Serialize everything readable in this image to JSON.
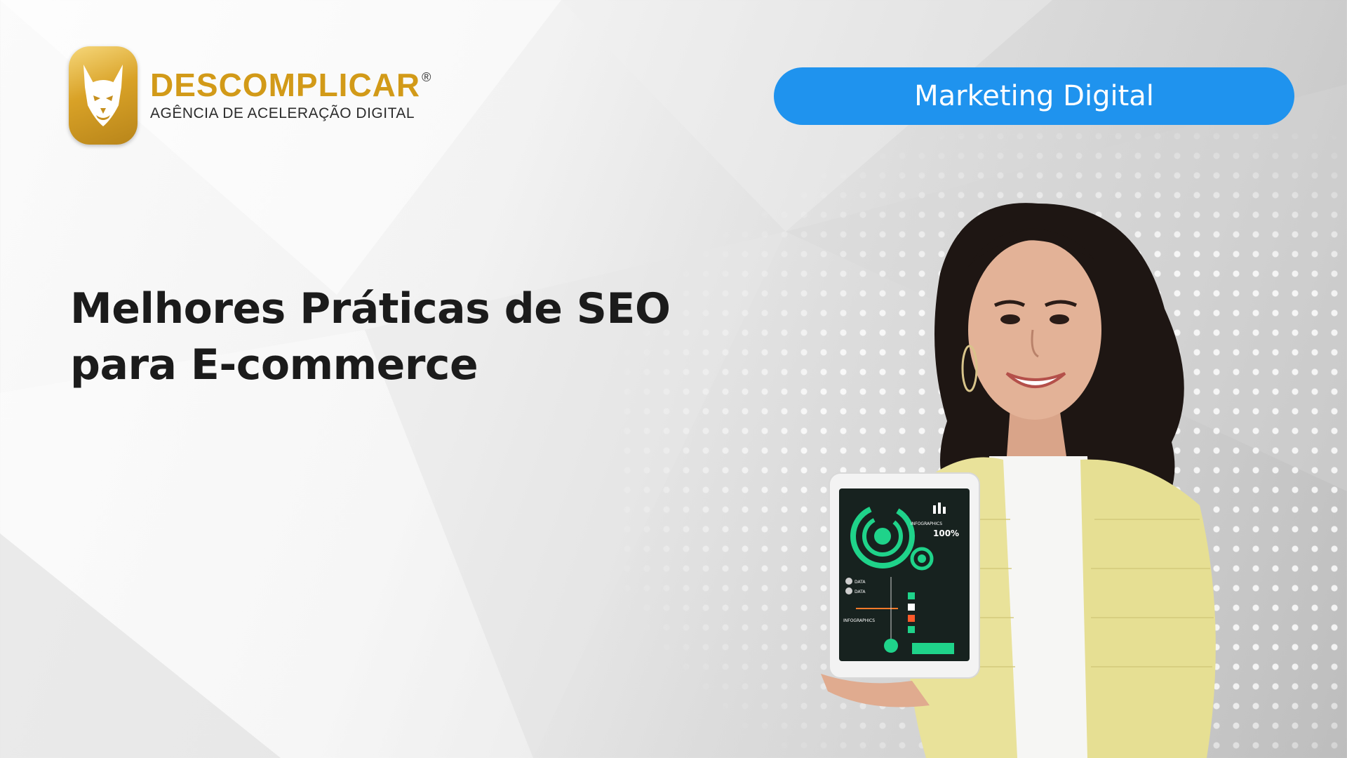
{
  "logo": {
    "brand": "DESCOMPLICAR",
    "registered_mark": "®",
    "tagline": "AGÊNCIA DE ACELERAÇÃO DIGITAL",
    "emblem_icon": "wolf-head-icon",
    "brand_color": "#d29a18"
  },
  "category": {
    "label": "Marketing Digital",
    "color": "#1f93ee"
  },
  "headline": {
    "line1": "Melhores Práticas de SEO",
    "line2": "para E-commerce"
  },
  "tablet_screen": {
    "label_infographics": "INFOGRAPHICS",
    "percent": "100%",
    "label_data_1": "DATA",
    "label_data_2": "DATA",
    "label_infographics_2": "INFOGRAPHICS"
  }
}
